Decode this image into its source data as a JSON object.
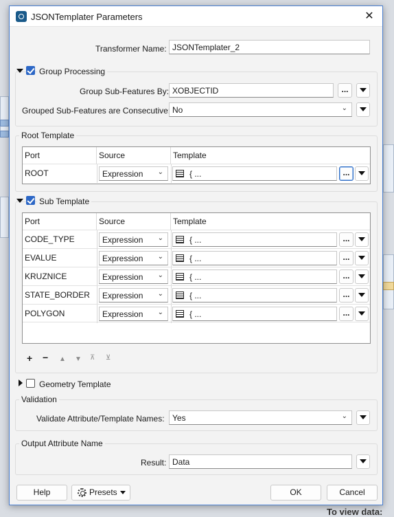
{
  "window": {
    "title": "JSONTemplater Parameters",
    "close_glyph": "✕"
  },
  "transformer_name": {
    "label": "Transformer Name:",
    "value": "JSONTemplater_2"
  },
  "group_processing": {
    "title": "Group Processing",
    "checked": true,
    "sub_features_by": {
      "label": "Group Sub-Features By:",
      "value": "XOBJECTID"
    },
    "consecutive": {
      "label": "Grouped Sub-Features are Consecutive:",
      "value": "No"
    }
  },
  "root_template": {
    "title": "Root Template",
    "headers": [
      "Port",
      "Source",
      "Template"
    ],
    "rows": [
      {
        "port": "ROOT",
        "source": "Expression",
        "template": "{ ..."
      }
    ]
  },
  "sub_template": {
    "title": "Sub Template",
    "checked": true,
    "headers": [
      "Port",
      "Source",
      "Template"
    ],
    "rows": [
      {
        "port": "CODE_TYPE",
        "source": "Expression",
        "template": "{ ..."
      },
      {
        "port": "EVALUE",
        "source": "Expression",
        "template": "{ ..."
      },
      {
        "port": "KRUZNICE",
        "source": "Expression",
        "template": "{ ..."
      },
      {
        "port": "STATE_BORDER",
        "source": "Expression",
        "template": "{ ..."
      },
      {
        "port": "POLYGON",
        "source": "Expression",
        "template": "{ ..."
      }
    ],
    "toolbar": [
      "add-icon",
      "remove-icon",
      "move-up-icon",
      "move-down-icon",
      "move-top-icon",
      "move-bottom-icon"
    ]
  },
  "geometry_template": {
    "title": "Geometry Template",
    "checked": false
  },
  "validation": {
    "title": "Validation",
    "validate": {
      "label": "Validate Attribute/Template Names:",
      "value": "Yes"
    }
  },
  "output_attribute": {
    "title": "Output Attribute Name",
    "result": {
      "label": "Result:",
      "value": "Data"
    }
  },
  "buttons": {
    "help": "Help",
    "presets": "Presets",
    "ok": "OK",
    "cancel": "Cancel",
    "ellipsis": "..."
  },
  "background": {
    "to_view_data": "To view data:"
  },
  "colors": {
    "accent": "#2c67c6",
    "window_border": "#4a7fd1"
  }
}
